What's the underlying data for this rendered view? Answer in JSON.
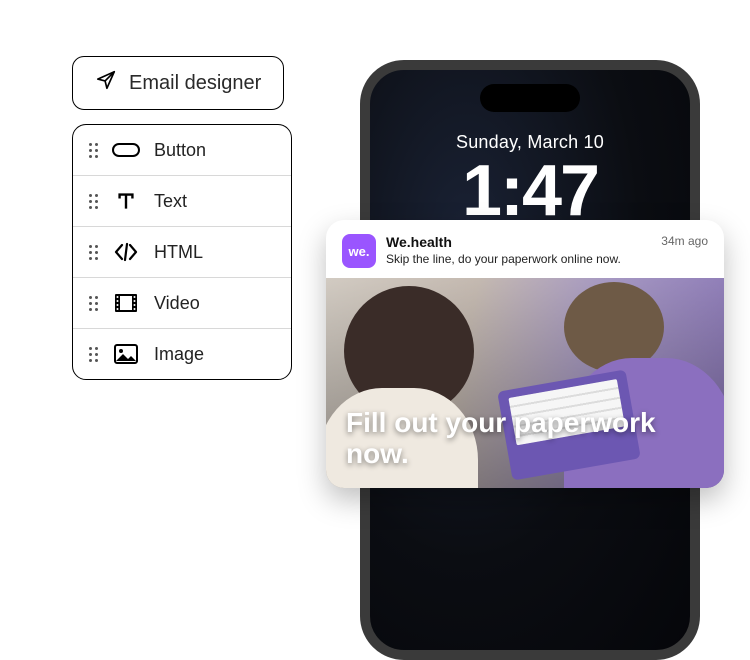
{
  "designer": {
    "label": "Email designer"
  },
  "components": [
    {
      "label": "Button"
    },
    {
      "label": "Text"
    },
    {
      "label": "HTML"
    },
    {
      "label": "Video"
    },
    {
      "label": "Image"
    }
  ],
  "lockscreen": {
    "date": "Sunday, March 10",
    "time": "1:47"
  },
  "notification": {
    "app_icon_text": "we.",
    "app_name": "We.health",
    "body": "Skip the line, do your paperwork online now.",
    "time": "34m ago",
    "overlay": "Fill out your paperwork now."
  }
}
